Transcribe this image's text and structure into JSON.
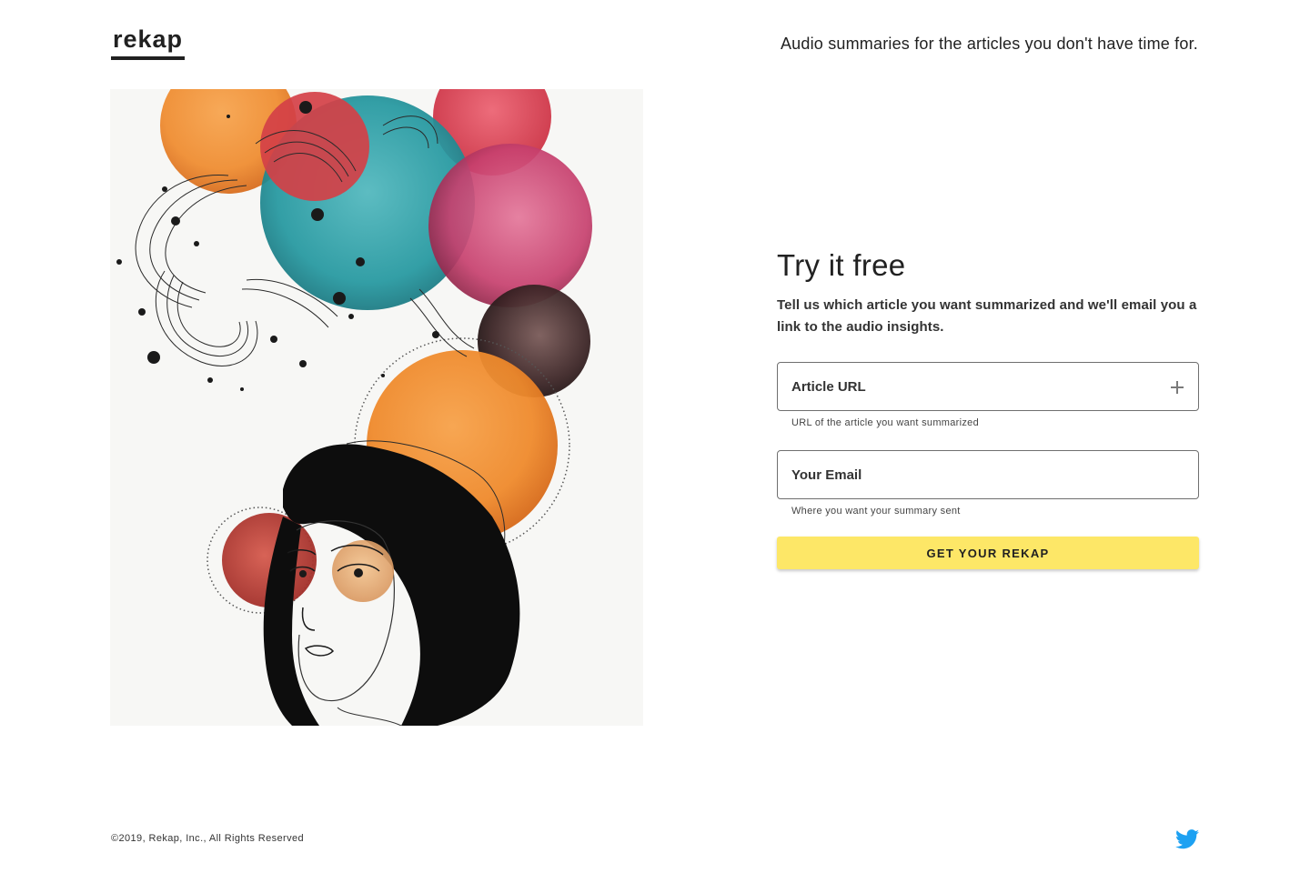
{
  "header": {
    "logo": "rekap",
    "tagline": "Audio summaries for the articles you don't have time for."
  },
  "form": {
    "title": "Try it free",
    "description": "Tell us which article you want summarized and we'll email you a link to the audio insights.",
    "url_field": {
      "placeholder": "Article URL",
      "helper": "URL of the article you want summarized",
      "icon": "plus-icon"
    },
    "email_field": {
      "placeholder": "Your Email",
      "helper": "Where you want your summary sent"
    },
    "submit_label": "GET YOUR REKAP",
    "accent_color": "#fde767"
  },
  "footer": {
    "copyright": "©2019, Rekap, Inc., All Rights Reserved",
    "social_icon": "twitter-icon",
    "social_color": "#1da1f2"
  }
}
